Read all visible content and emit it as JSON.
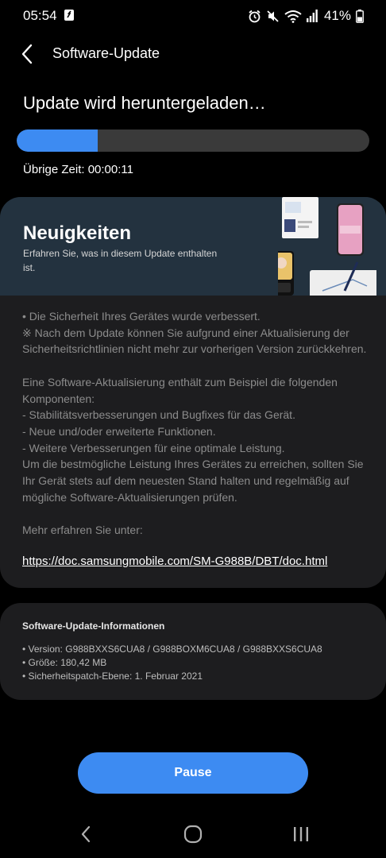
{
  "status_bar": {
    "time": "05:54",
    "battery_percent": "41%",
    "icons": [
      "nfc-icon",
      "alarm-icon",
      "mute-icon",
      "wifi-icon",
      "signal-icon",
      "battery-icon"
    ]
  },
  "app_bar": {
    "title": "Software-Update"
  },
  "download": {
    "title": "Update wird heruntergeladen…",
    "progress": 0.23,
    "remaining_label": "Übrige Zeit: 00:00:11"
  },
  "news": {
    "title": "Neuigkeiten",
    "subtitle": "Erfahren Sie, was in diesem Update enthalten ist.",
    "body": "• Die Sicherheit Ihres Gerätes wurde verbessert.\n※ Nach dem Update können Sie aufgrund einer Aktualisierung der Sicherheitsrichtlinien nicht mehr zur vorherigen Version zurückkehren.\n\nEine Software-Aktualisierung enthält zum Beispiel die folgenden Komponenten:\n - Stabilitätsverbesserungen und Bugfixes für das Gerät.\n - Neue und/oder erweiterte Funktionen.\n - Weitere Verbesserungen für eine optimale Leistung.\nUm die bestmögliche Leistung Ihres Gerätes zu erreichen, sollten Sie Ihr Gerät stets auf dem neuesten Stand halten und regelmäßig auf mögliche Software-Aktualisierungen prüfen.\n\nMehr erfahren Sie unter:",
    "link": "https://doc.samsungmobile.com/SM-G988B/DBT/doc.html"
  },
  "info": {
    "title": "Software-Update-Informationen",
    "version": "• Version: G988BXXS6CUA8 / G988BOXM6CUA8 / G988BXXS6CUA8",
    "size": "• Größe: 180,42 MB",
    "patch": "• Sicherheitspatch-Ebene: 1. Februar 2021"
  },
  "pause_label": "Pause",
  "colors": {
    "accent": "#3d8bf2",
    "card": "#1d1d1f",
    "hero": "#23323f"
  }
}
